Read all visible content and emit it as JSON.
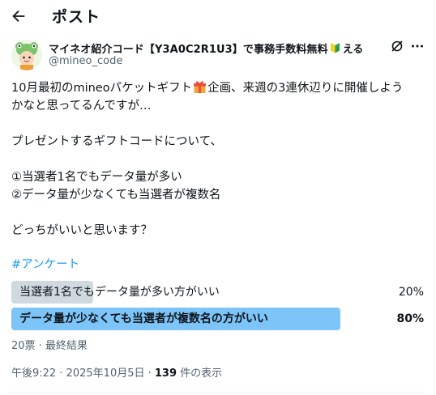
{
  "header": {
    "title": "ポスト",
    "back_icon": "arrow-left-icon"
  },
  "author": {
    "display_name": "マイネオ紹介コード【Y3A0C2R1U3】で事務手数料無料",
    "name_suffix": "える",
    "badge_icon": "beginner-mark-icon",
    "handle": "@mineo_code",
    "avatar_icon": "frog-avatar-icon"
  },
  "actions": {
    "grok_icon": "grok-icon",
    "more_icon": "more-horizontal-icon"
  },
  "post": {
    "line1_a": "10月最初のmineoパケットギフト",
    "gift_icon": "gift-emoji-icon",
    "line1_b": "企画、来週の3連休辺りに開催しよう",
    "line2": "かなと思ってるんですが…",
    "line3": "プレゼントするギフトコードについて、",
    "line4": "①当選者1名でもデータ量が多い",
    "line5": "②データ量が少なくても当選者が複数名",
    "line6": "どっちがいいと思います？",
    "hashtag": "#アンケート"
  },
  "poll": {
    "options": [
      {
        "label": "当選者1名でもデータ量が多い方がいい",
        "percent_label": "20%",
        "percent": 20
      },
      {
        "label": "データ量が少なくても当選者が複数名の方がいい",
        "percent_label": "80%",
        "percent": 80
      }
    ],
    "winner_color": "#7dc4f8",
    "loser_color": "#cfd9de",
    "meta": "20票 · 最終結果"
  },
  "timestamp": {
    "time": "午後9:22 · 2025年10月5日 · ",
    "views_count": "139",
    "views_suffix": " 件の表示"
  }
}
